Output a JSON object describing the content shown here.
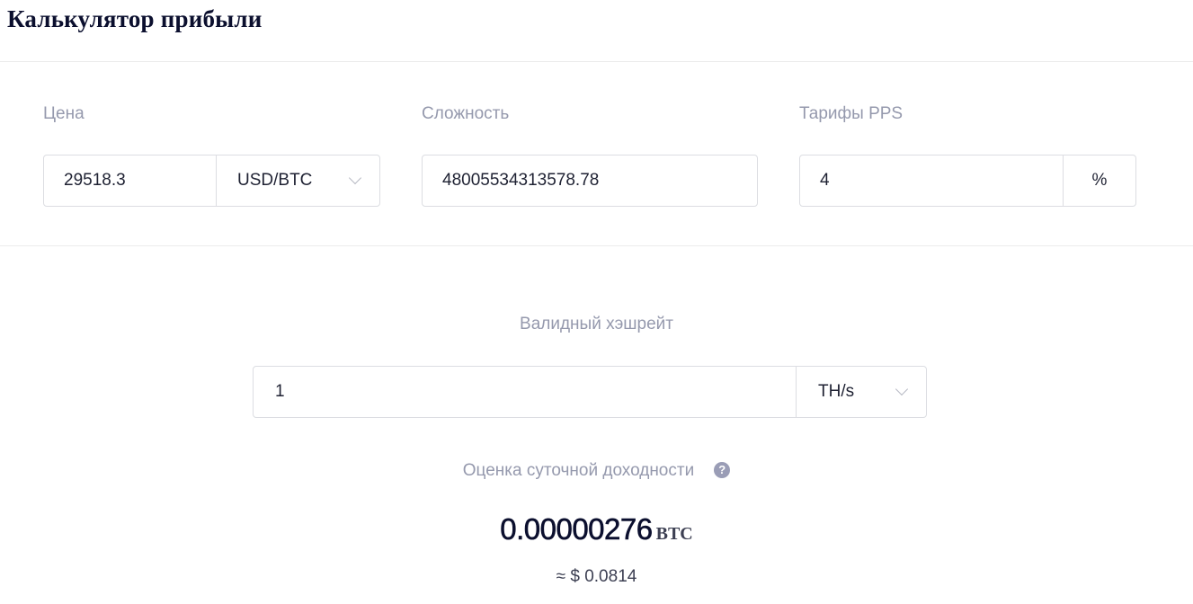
{
  "page": {
    "title": "Калькулятор прибыли"
  },
  "price": {
    "label": "Цена",
    "value": "29518.3",
    "unit": "USD/BTC"
  },
  "difficulty": {
    "label": "Сложность",
    "value": "48005534313578.78"
  },
  "pps": {
    "label": "Тарифы PPS",
    "value": "4",
    "unit": "%"
  },
  "hashrate": {
    "label": "Валидный хэшрейт",
    "value": "1",
    "unit": "TH/s"
  },
  "estimate": {
    "label": "Оценка суточной доходности",
    "help_icon": "?",
    "btc_value": "0.00000276",
    "btc_unit": "BTC",
    "usd_value": "≈ $ 0.0814"
  }
}
